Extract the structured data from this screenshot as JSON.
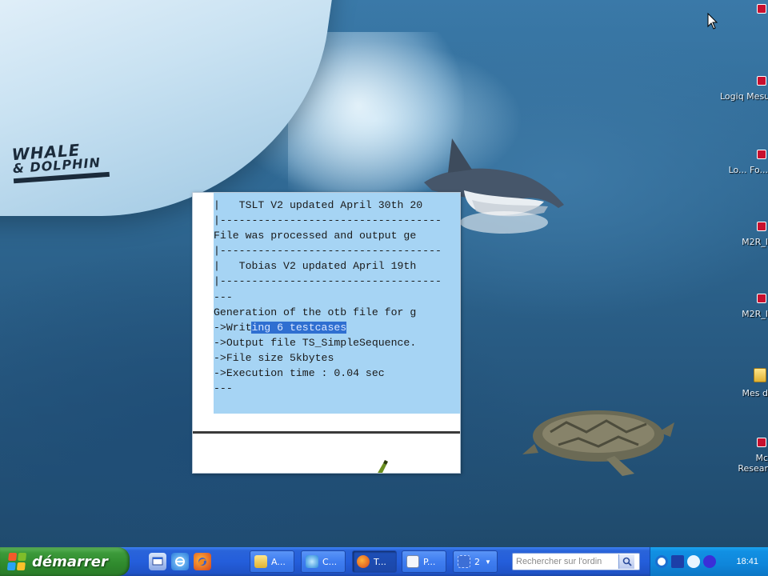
{
  "console": {
    "lines_before_highlight": [
      "|   TSLT V2 updated April 30th 20",
      "|-----------------------------------",
      "File was processed and output ge",
      "|-----------------------------------",
      "|   Tobias V2 updated April 19th",
      "|-----------------------------------",
      "---",
      "Generation of the otb file for g"
    ],
    "writing_prefix": "->Writ",
    "writing_highlight": "ing 6 testcases",
    "lines_after_highlight": [
      "->Output file TS_SimpleSequence.",
      "->File size 5kbytes",
      "->Execution time : 0.04 sec",
      "---"
    ]
  },
  "wallpaper": {
    "boat_logo_line1": "WHALE",
    "boat_logo_line2": "& DOLPHIN"
  },
  "desktop_icons": [
    {
      "label": "",
      "icon": "shortcut-icon"
    },
    {
      "label": "Logiq Mesure",
      "icon": "shortcut-icon"
    },
    {
      "label": "Lo... Fo...",
      "icon": "shortcut-icon"
    },
    {
      "label": "M2R_I",
      "icon": "shortcut-icon"
    },
    {
      "label": "M2R_I",
      "icon": "shortcut-icon"
    },
    {
      "label": "Mes d",
      "icon": "folder-icon"
    },
    {
      "label": "Mc Resear",
      "icon": "shortcut-icon"
    }
  ],
  "taskbar": {
    "start_label": "démarrer",
    "quick_launch": [
      "show-desktop-icon",
      "ie-icon",
      "firefox-icon"
    ],
    "tasks": [
      {
        "label": "A...",
        "icon": "folder-icon",
        "color": "#f1c34a",
        "active": false
      },
      {
        "label": "C...",
        "icon": "app-icon",
        "color": "#4ac0f1",
        "active": false
      },
      {
        "label": "T...",
        "icon": "firefox-icon",
        "color": "#e0561f",
        "active": true
      },
      {
        "label": "P...",
        "icon": "document-icon",
        "color": "#e8eefc",
        "active": false
      },
      {
        "label": "2",
        "icon": "window-group-icon",
        "color": "#3d6fd6",
        "active": false
      }
    ],
    "search_placeholder": "Rechercher sur l'ordin",
    "clock": "18:41"
  },
  "colors": {
    "console_background": "#a6d4f4",
    "selection": "#2f6fd1",
    "taskbar": "#245edb",
    "start_button": "#3c9a3a",
    "tray": "#0f86da"
  }
}
